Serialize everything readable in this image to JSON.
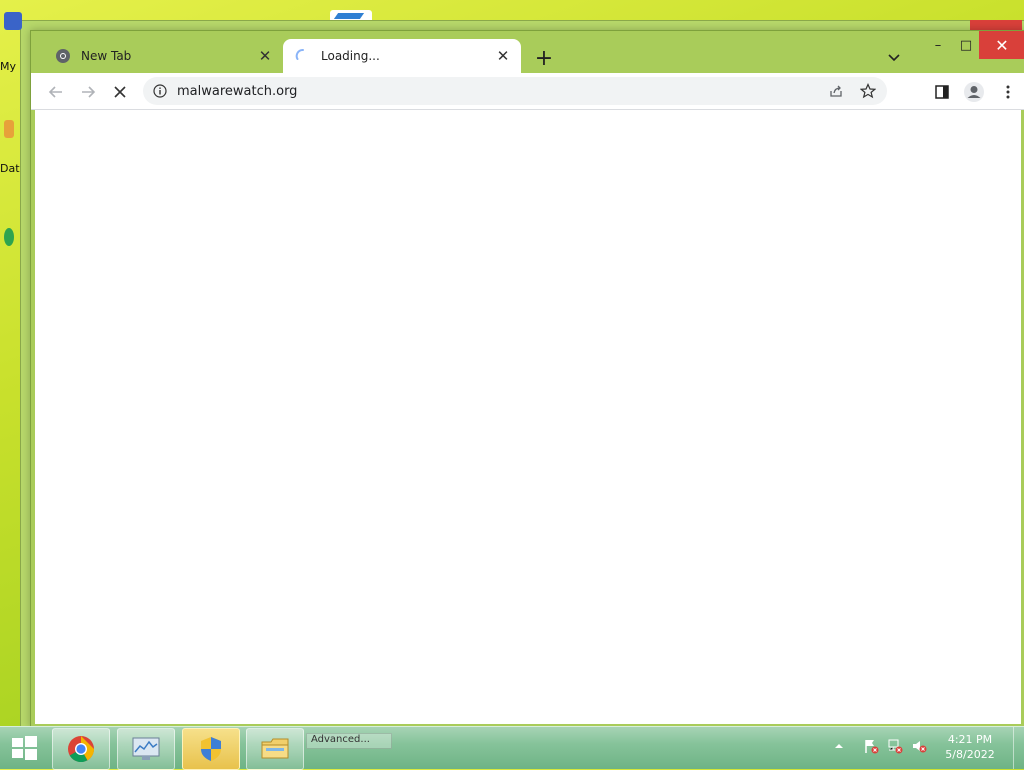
{
  "desktop": {
    "icons": [
      {
        "label": "My"
      },
      {
        "label": "Dat"
      }
    ]
  },
  "browser": {
    "tabs": [
      {
        "title": "New Tab",
        "state": "inactive",
        "icon": "chrome-icon"
      },
      {
        "title": "Loading...",
        "state": "active",
        "icon": "loading-spinner-icon"
      }
    ],
    "new_tab_symbol": "+",
    "address": "malwarewatch.org",
    "window_controls": {
      "minimize": "–",
      "maximize": "□",
      "close": "✕"
    }
  },
  "taskbar": {
    "items": [
      {
        "name": "chrome",
        "icon": "chrome-icon"
      },
      {
        "name": "resource-monitor",
        "icon": "monitor-icon"
      },
      {
        "name": "uac",
        "icon": "shield-icon",
        "active": true
      },
      {
        "name": "explorer",
        "icon": "folder-icon"
      }
    ],
    "hidden_label": "Advanced...",
    "clock": {
      "time": "4:21 PM",
      "date": "5/8/2022"
    }
  },
  "colors": {
    "titlebar": "#a9cc5a",
    "close_red": "#d9403a",
    "taskbar": "#86c39a"
  }
}
